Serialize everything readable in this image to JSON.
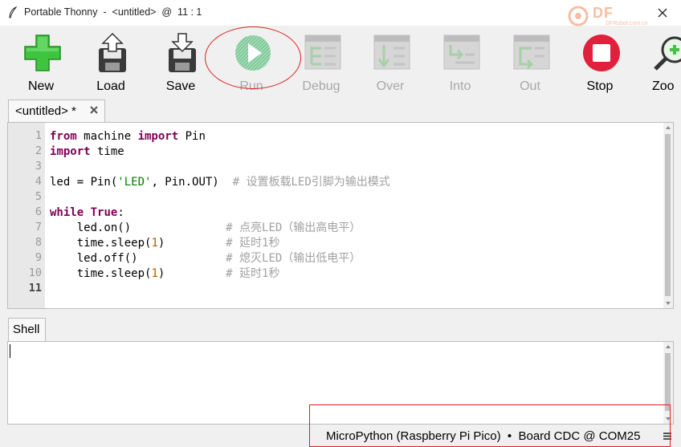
{
  "window": {
    "title": "Portable Thonny  -  <untitled>  @  11 : 1",
    "watermark_text": "DF",
    "watermark_sub": "DFRobot.com.cn",
    "icons": {
      "app": "feather-icon",
      "close": "close-icon"
    }
  },
  "toolbar": {
    "buttons": [
      {
        "label": "New",
        "icon": "new-file-icon",
        "enabled": true
      },
      {
        "label": "Load",
        "icon": "load-file-icon",
        "enabled": true
      },
      {
        "label": "Save",
        "icon": "save-file-icon",
        "enabled": true
      },
      {
        "label": "Run",
        "icon": "run-icon",
        "enabled": false
      },
      {
        "label": "Debug",
        "icon": "debug-icon",
        "enabled": false
      },
      {
        "label": "Over",
        "icon": "step-over-icon",
        "enabled": false
      },
      {
        "label": "Into",
        "icon": "step-into-icon",
        "enabled": false
      },
      {
        "label": "Out",
        "icon": "step-out-icon",
        "enabled": false
      },
      {
        "label": "Stop",
        "icon": "stop-icon",
        "enabled": true
      },
      {
        "label": "Zoo",
        "icon": "zoom-icon",
        "enabled": true
      }
    ]
  },
  "editor": {
    "tab_title": "<untitled> *",
    "line_numbers": [
      "1",
      "2",
      "3",
      "4",
      "5",
      "6",
      "7",
      "8",
      "9",
      "10",
      "11"
    ],
    "current_line": "11",
    "lines": [
      [
        {
          "t": "from",
          "c": "kw"
        },
        {
          "t": " machine ",
          "c": ""
        },
        {
          "t": "import",
          "c": "kw"
        },
        {
          "t": " Pin",
          "c": ""
        }
      ],
      [
        {
          "t": "import",
          "c": "kw"
        },
        {
          "t": " time",
          "c": ""
        }
      ],
      [],
      [
        {
          "t": "led = Pin(",
          "c": ""
        },
        {
          "t": "'LED'",
          "c": "str"
        },
        {
          "t": ", Pin.OUT)  ",
          "c": ""
        },
        {
          "t": "# 设置板载LED引脚为输出模式",
          "c": "com"
        }
      ],
      [],
      [
        {
          "t": "while",
          "c": "kw"
        },
        {
          "t": " ",
          "c": ""
        },
        {
          "t": "True",
          "c": "kw"
        },
        {
          "t": ":",
          "c": ""
        }
      ],
      [
        {
          "t": "    led.on()              ",
          "c": ""
        },
        {
          "t": "# 点亮LED（输出高电平）",
          "c": "com"
        }
      ],
      [
        {
          "t": "    time.sleep(",
          "c": ""
        },
        {
          "t": "1",
          "c": "num"
        },
        {
          "t": ")         ",
          "c": ""
        },
        {
          "t": "# 延时1秒",
          "c": "com"
        }
      ],
      [
        {
          "t": "    led.off()             ",
          "c": ""
        },
        {
          "t": "# 熄灭LED（输出低电平）",
          "c": "com"
        }
      ],
      [
        {
          "t": "    time.sleep(",
          "c": ""
        },
        {
          "t": "1",
          "c": "num"
        },
        {
          "t": ")         ",
          "c": ""
        },
        {
          "t": "# 延时1秒",
          "c": "com"
        }
      ],
      []
    ]
  },
  "shell": {
    "tab_title": "Shell"
  },
  "statusbar": {
    "text": "MicroPython (Raspberry Pi Pico)  •  Board CDC @ COM25",
    "menu_icon": "hamburger-menu-icon"
  },
  "colors": {
    "annotation": "#e02020",
    "keyword": "#7f0055",
    "string": "#008000",
    "number": "#b15c00",
    "comment": "#a0a0a0"
  }
}
